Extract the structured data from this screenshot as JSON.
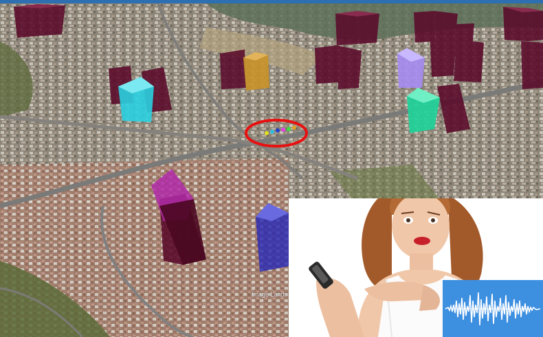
{
  "map": {
    "watermark": "Image Lands"
  },
  "colors": {
    "top_bar": "#2d6fb0",
    "tower_maroon": "#5a0a2a",
    "tower_cyan": "#2ad0e0",
    "tower_gold": "#c8922a",
    "tower_lavender": "#a58cf0",
    "tower_green": "#20d29a",
    "tower_magenta": "#b02aa8",
    "tower_blue": "#2a2ab4",
    "highlight_ring": "#e81010",
    "wave_bg": "#3d8fe0"
  },
  "icons": {
    "waveform": "audio-waveform-icon",
    "phone": "mobile-phone-icon"
  }
}
